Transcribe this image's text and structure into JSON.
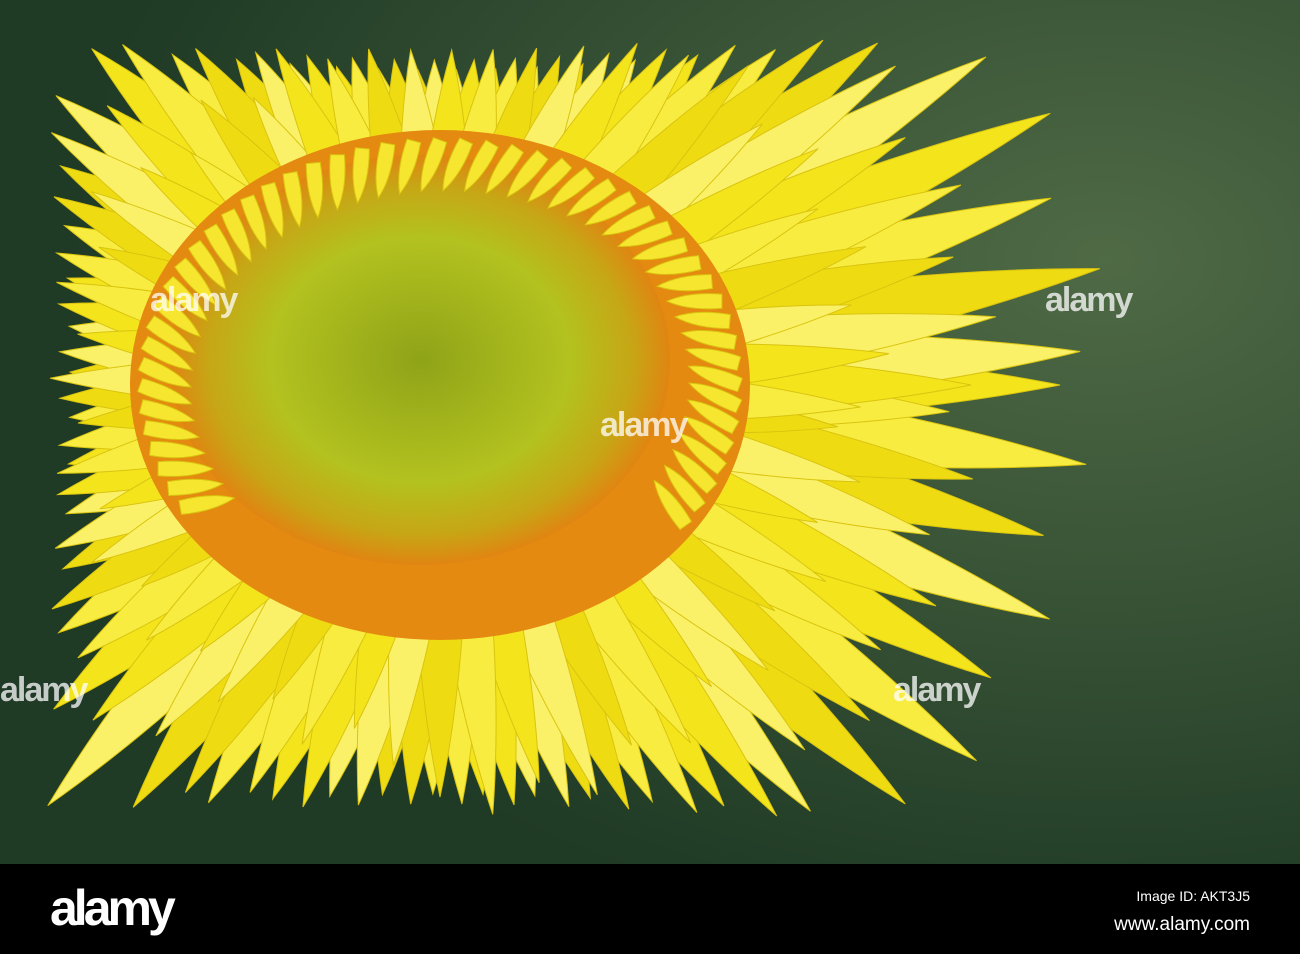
{
  "photo": {
    "subject": "yellow strawflower"
  },
  "watermark": {
    "text": "alamy"
  },
  "footer": {
    "logo": "alamy",
    "image_id": "Image ID: AKT3J5",
    "website": "www.alamy.com"
  },
  "colors": {
    "background": "#2f4f2c",
    "petal": "#f2e51e",
    "disk_ring": "#e38a12",
    "disk_center": "#a9b81e"
  }
}
